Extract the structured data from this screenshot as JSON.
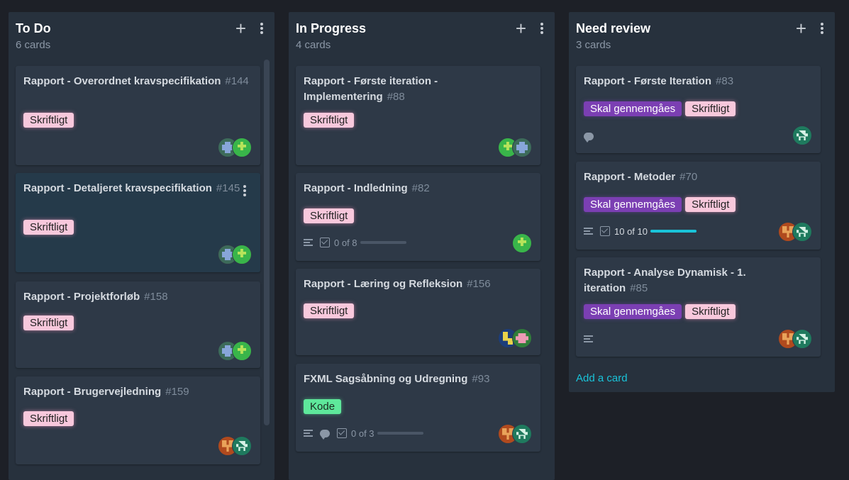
{
  "columns": [
    {
      "title": "To Do",
      "count": "6 cards",
      "cards": [
        {
          "title": "Rapport - Overordnet kravspecifikation",
          "number": "#144",
          "labels": [
            "Skriftligt"
          ]
        },
        {
          "title": "Rapport - Detaljeret kravspecifikation",
          "number": "#145",
          "labels": [
            "Skriftligt"
          ]
        },
        {
          "title": "Rapport - Projektforløb",
          "number": "#158",
          "labels": [
            "Skriftligt"
          ]
        },
        {
          "title": "Rapport - Brugervejledning",
          "number": "#159",
          "labels": [
            "Skriftligt"
          ]
        }
      ]
    },
    {
      "title": "In Progress",
      "count": "4 cards",
      "cards": [
        {
          "title": "Rapport - Første iteration - Implementering",
          "number": "#88",
          "labels": [
            "Skriftligt"
          ]
        },
        {
          "title": "Rapport - Indledning",
          "number": "#82",
          "labels": [
            "Skriftligt"
          ],
          "checklist": "0 of 8",
          "progress": 0
        },
        {
          "title": "Rapport - Læring og Refleksion",
          "number": "#156",
          "labels": [
            "Skriftligt"
          ]
        },
        {
          "title": "FXML Sagsåbning og Udregning",
          "number": "#93",
          "labels": [
            "Kode"
          ],
          "checklist": "0 of 3",
          "progress": 0
        }
      ]
    },
    {
      "title": "Need review",
      "count": "3 cards",
      "add_card": "Add a card",
      "cards": [
        {
          "title": "Rapport - Første Iteration",
          "number": "#83",
          "labels": [
            "Skal gennemgåes",
            "Skriftligt"
          ]
        },
        {
          "title": "Rapport - Metoder",
          "number": "#70",
          "labels": [
            "Skal gennemgåes",
            "Skriftligt"
          ],
          "checklist": "10 of 10",
          "progress": 1
        },
        {
          "title": "Rapport - Analyse Dynamisk - 1. iteration",
          "number": "#85",
          "labels": [
            "Skal gennemgåes",
            "Skriftligt"
          ]
        }
      ]
    }
  ],
  "icons": {
    "add": "plus-icon",
    "more": "kebab-icon"
  },
  "colors": {
    "background": "#1d2027",
    "column": "#27313d",
    "card": "#2e3947",
    "accent": "#19c3d9",
    "label_skriftligt": "#f8c8dc",
    "label_skal": "#7b3fb3",
    "label_kode": "#5ee89b"
  }
}
